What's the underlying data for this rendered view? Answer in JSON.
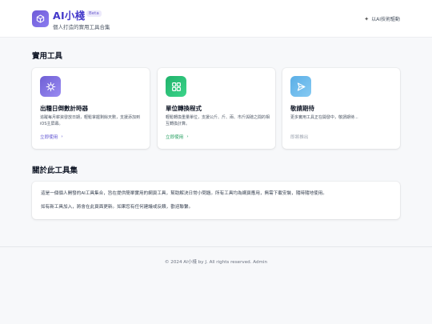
{
  "header": {
    "title": "AI小棧",
    "badge": "Beta",
    "subtitle": "個人打造的實用工具合集",
    "powered": "以AI技術驅動"
  },
  "tools": {
    "section_title": "實用工具",
    "cards": [
      {
        "name": "出糧日倒數計時器",
        "desc": "追蹤每月薪資發放日期，輕鬆掌握剩餘天數，支援添加到iOS主屏幕。",
        "action": "立即使用",
        "icon": "hourglass-icon",
        "color": "#6e5ed4"
      },
      {
        "name": "單位轉換程式",
        "desc": "輕鬆轉換重量單位，支援公斤、斤、兩、市斤與磅之間的相互轉換計算。",
        "action": "立即使用",
        "icon": "grid-icon",
        "color": "#20b26b"
      },
      {
        "name": "敬請期待",
        "desc": "更多實用工具正在開發中，敬請期待...",
        "action": "即將推出",
        "icon": "send-icon",
        "color": "#5aaee6"
      }
    ]
  },
  "about": {
    "section_title": "關於此工具集",
    "p1": "這是一個個人開發的AI工具集合，旨在提供簡單實用的網頁工具，幫助解決日常小問題。所有工具均為網頁應用，無需下載安裝，隨時隨地使用。",
    "p2": "如有新工具加入，將會在此頁面更新。如果您有任何建議或反饋，歡迎聯繫。"
  },
  "footer": {
    "text": "© 2024 AI小棧 by J. All rights reserved. Admin"
  }
}
